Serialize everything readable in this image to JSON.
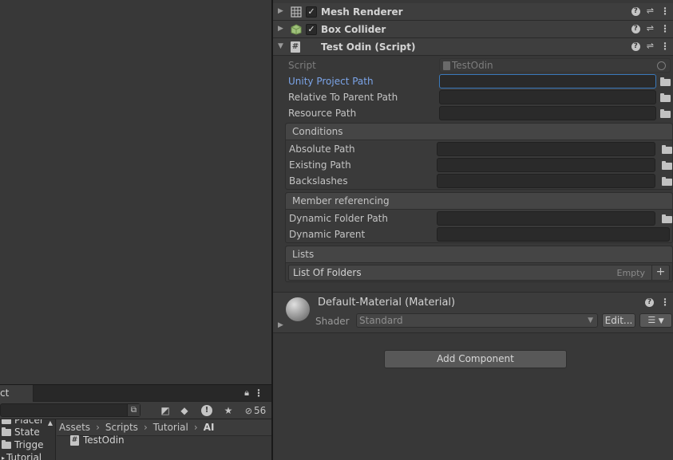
{
  "project": {
    "tab_label": "ct",
    "hidden_count": "56",
    "tree": [
      "Placer",
      "State",
      "Trigge",
      "Tutorial"
    ],
    "breadcrumb": [
      "Assets",
      "Scripts",
      "Tutorial",
      "AI"
    ],
    "asset": "TestOdin"
  },
  "inspector": {
    "components": [
      {
        "title": "Mesh Renderer",
        "icon": "mesh-renderer-icon",
        "enabled": true
      },
      {
        "title": "Box Collider",
        "icon": "box-collider-icon",
        "enabled": true
      },
      {
        "title": "Test Odin (Script)",
        "icon": "script-icon"
      }
    ],
    "script": {
      "label": "Script",
      "value": "TestOdin"
    },
    "fields": [
      {
        "label": "Unity Project Path",
        "value": ""
      },
      {
        "label": "Relative To Parent Path",
        "value": ""
      },
      {
        "label": "Resource Path",
        "value": ""
      }
    ],
    "conditions": {
      "title": "Conditions",
      "fields": [
        "Absolute Path",
        "Existing Path",
        "Backslashes"
      ]
    },
    "member_referencing": {
      "title": "Member referencing",
      "fields": [
        "Dynamic Folder Path",
        "Dynamic Parent"
      ]
    },
    "lists": {
      "title": "Lists",
      "list_label": "List Of Folders",
      "empty_label": "Empty",
      "add_label": "+"
    },
    "material": {
      "title": "Default-Material (Material)",
      "shader_label": "Shader",
      "shader_value": "Standard",
      "edit_label": "Edit..."
    },
    "add_component_label": "Add Component"
  },
  "colors": {
    "accent_blue": "#7ba4e8",
    "focus_border": "#3a79bb",
    "background": "#383838"
  }
}
